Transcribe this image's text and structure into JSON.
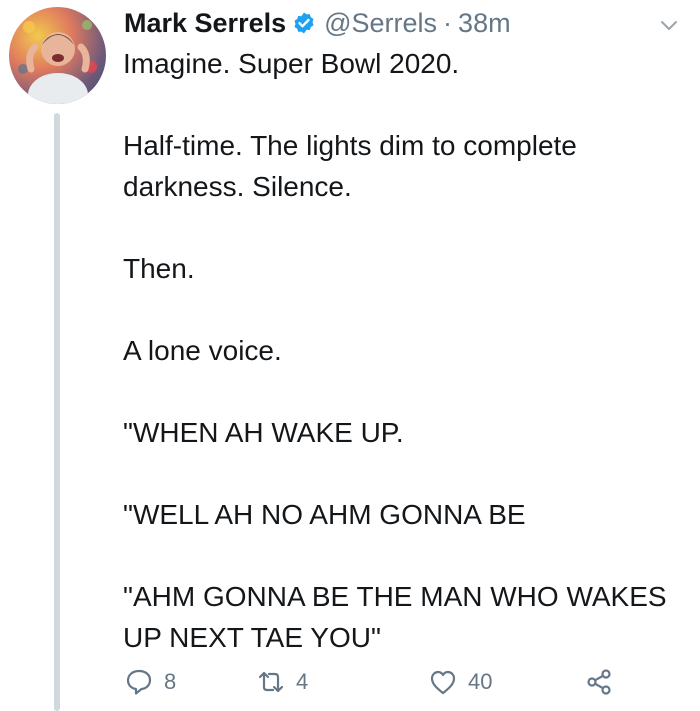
{
  "tweet": {
    "author_name": "Mark Serrels",
    "handle": "@Serrels",
    "separator": "·",
    "time": "38m",
    "paragraphs": [
      "Imagine. Super Bowl 2020.",
      "",
      "Half-time. The lights dim to complete darkness. Silence.",
      "",
      "Then.",
      "",
      "A lone voice.",
      "",
      "\"WHEN AH WAKE UP.",
      "",
      "\"WELL AH NO AHM GONNA BE",
      "",
      "\"AHM GONNA BE THE MAN WHO WAKES UP NEXT TAE YOU\""
    ]
  },
  "actions": {
    "reply_count": "8",
    "retweet_count": "4",
    "like_count": "40"
  },
  "icons": {
    "verified": "verified-badge-icon",
    "caret": "chevron-down-icon",
    "reply": "reply-icon",
    "retweet": "retweet-icon",
    "like": "heart-icon",
    "share": "share-icon"
  },
  "colors": {
    "text": "#14171a",
    "muted": "#657786",
    "verified": "#1da1f2",
    "thread_line": "#cfd9de"
  }
}
